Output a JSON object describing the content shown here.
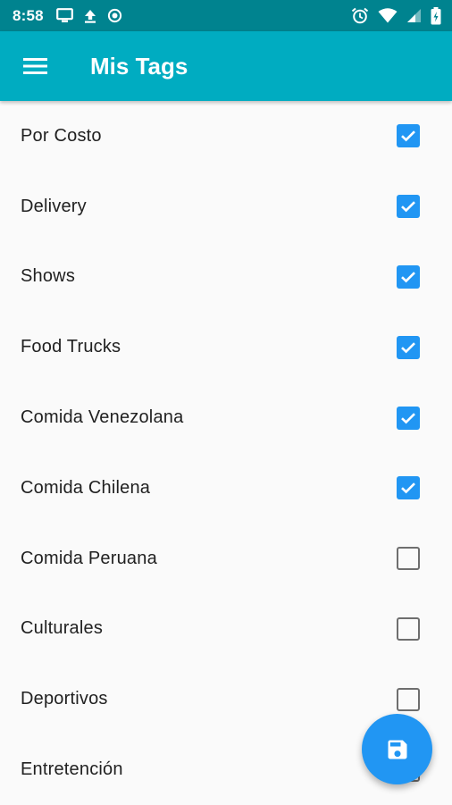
{
  "status_bar": {
    "time": "8:58",
    "icons_left": [
      "monitor-icon",
      "upload-icon",
      "record-icon"
    ],
    "icons_right": [
      "alarm-icon",
      "wifi-icon",
      "signal-icon",
      "battery-icon"
    ]
  },
  "app_bar": {
    "title": "Mis Tags",
    "menu_icon": "hamburger-menu-icon"
  },
  "tags": [
    {
      "label": "Por Costo",
      "checked": true
    },
    {
      "label": "Delivery",
      "checked": true
    },
    {
      "label": "Shows",
      "checked": true
    },
    {
      "label": "Food Trucks",
      "checked": true
    },
    {
      "label": "Comida Venezolana",
      "checked": true
    },
    {
      "label": "Comida Chilena",
      "checked": true
    },
    {
      "label": "Comida Peruana",
      "checked": false
    },
    {
      "label": "Culturales",
      "checked": false
    },
    {
      "label": "Deportivos",
      "checked": false
    },
    {
      "label": "Entretención",
      "checked": false
    }
  ],
  "fab": {
    "icon": "save-icon"
  },
  "colors": {
    "status_bar": "#00838f",
    "app_bar": "#00acc1",
    "accent": "#2196f3",
    "background": "#fafafa"
  }
}
